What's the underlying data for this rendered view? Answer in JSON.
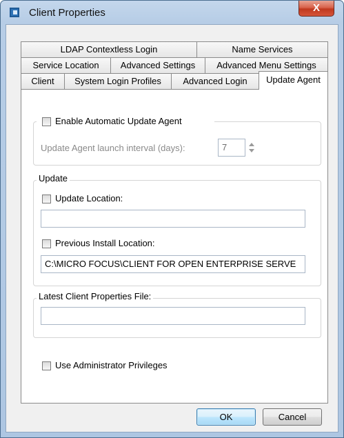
{
  "window": {
    "title": "Client Properties",
    "close_label": "X"
  },
  "tabs": {
    "row1": [
      "LDAP Contextless Login",
      "Name Services"
    ],
    "row2": [
      "Service Location",
      "Advanced Settings",
      "Advanced Menu Settings"
    ],
    "row3": [
      "Client",
      "System Login Profiles",
      "Advanced Login",
      "Update Agent"
    ],
    "active": "Update Agent"
  },
  "update_agent": {
    "enable_label": "Enable Automatic Update Agent",
    "enable_checked": false,
    "interval_label": "Update Agent launch interval (days):",
    "interval_value": "7"
  },
  "update": {
    "group_label": "Update",
    "update_location_label": "Update Location:",
    "update_location_checked": false,
    "update_location_value": "",
    "previous_install_label": "Previous Install Location:",
    "previous_install_checked": false,
    "previous_install_value": "C:\\MICRO FOCUS\\CLIENT FOR OPEN ENTERPRISE SERVE"
  },
  "latest": {
    "group_label": "Latest Client Properties File:",
    "value": ""
  },
  "admin": {
    "label": "Use Administrator Privileges",
    "checked": false
  },
  "buttons": {
    "ok": "OK",
    "cancel": "Cancel"
  }
}
